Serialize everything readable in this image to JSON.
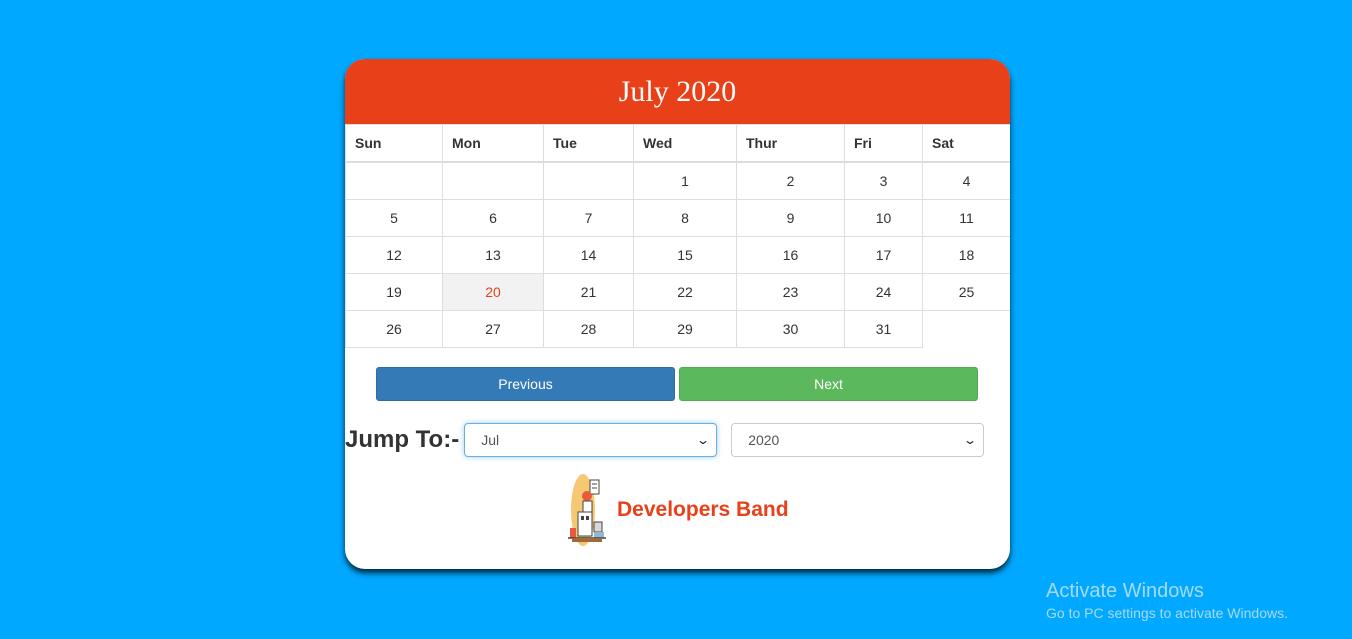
{
  "calendar": {
    "title": "July 2020",
    "weekdays": [
      "Sun",
      "Mon",
      "Tue",
      "Wed",
      "Thur",
      "Fri",
      "Sat"
    ],
    "weeks": [
      [
        "",
        "",
        "",
        "1",
        "2",
        "3",
        "4"
      ],
      [
        "5",
        "6",
        "7",
        "8",
        "9",
        "10",
        "11"
      ],
      [
        "12",
        "13",
        "14",
        "15",
        "16",
        "17",
        "18"
      ],
      [
        "19",
        "20",
        "21",
        "22",
        "23",
        "24",
        "25"
      ],
      [
        "26",
        "27",
        "28",
        "29",
        "30",
        "31",
        ""
      ]
    ],
    "today": "20",
    "today_color": "#e84018",
    "header_color": "#e84018"
  },
  "nav": {
    "previous_label": "Previous",
    "next_label": "Next"
  },
  "jump": {
    "label": "Jump To:-",
    "month_selected": "Jul",
    "year_selected": "2020"
  },
  "brand": {
    "name": "Developers Band",
    "logo_icon": "developer-desk-illustration"
  },
  "watermark": {
    "title": "Activate Windows",
    "subtitle": "Go to PC settings to activate Windows."
  }
}
